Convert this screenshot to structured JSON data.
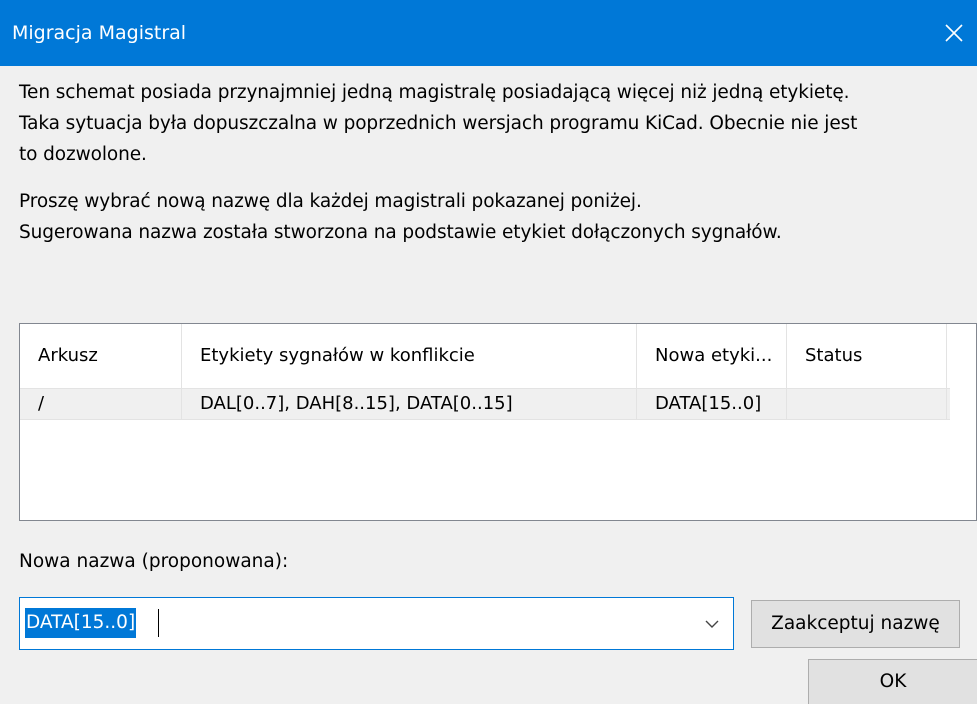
{
  "window": {
    "title": "Migracja Magistral",
    "close_icon": "close-icon"
  },
  "message": {
    "line1": "Ten schemat posiada przynajmniej jedną magistralę posiadającą więcej niż jedną etykietę.",
    "line2": "Taka sytuacja była dopuszczalna w poprzednich wersjach programu KiCad. Obecnie nie jest",
    "line3": "to dozwolone.",
    "line4": "Proszę wybrać nową nazwę dla każdej magistrali pokazanej poniżej.",
    "line5": "Sugerowana nazwa została stworzona na podstawie etykiet dołączonych sygnałów."
  },
  "table": {
    "columns": [
      "Arkusz",
      "Etykiety sygnałów w konflikcie",
      "Nowa etyki...",
      "Status"
    ],
    "rows": [
      [
        "/",
        "DAL[0..7], DAH[8..15], DATA[0..15]",
        "DATA[15..0]",
        ""
      ]
    ]
  },
  "new_name": {
    "label": "Nowa nazwa (proponowana):",
    "value": "DATA[15..0]",
    "dropdown_icon": "chevron-down-icon"
  },
  "buttons": {
    "accept": "Zaakceptuj nazwę",
    "ok": "OK"
  },
  "colors": {
    "titlebar": "#0078d7",
    "selection": "#0078d7",
    "background": "#f0f0f0"
  }
}
